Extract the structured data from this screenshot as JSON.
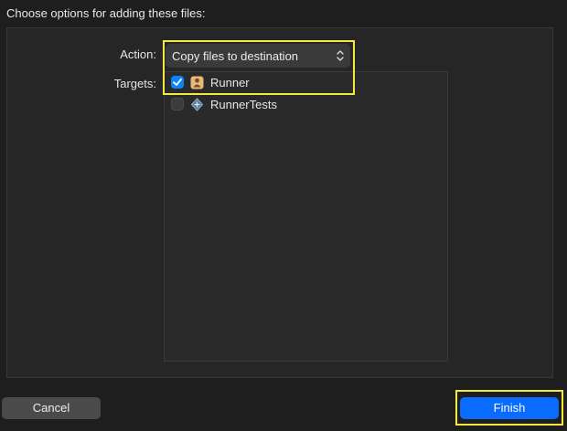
{
  "dialog": {
    "title": "Choose options for adding these files:"
  },
  "form": {
    "action_label": "Action:",
    "action_value": "Copy files to destination",
    "targets_label": "Targets:"
  },
  "targets": [
    {
      "label": "Runner",
      "checked": true,
      "icon": "app-target-icon"
    },
    {
      "label": "RunnerTests",
      "checked": false,
      "icon": "test-target-icon"
    }
  ],
  "buttons": {
    "cancel": "Cancel",
    "finish": "Finish"
  },
  "colors": {
    "accent": "#0a84ff",
    "highlight": "#f4ea3d"
  }
}
